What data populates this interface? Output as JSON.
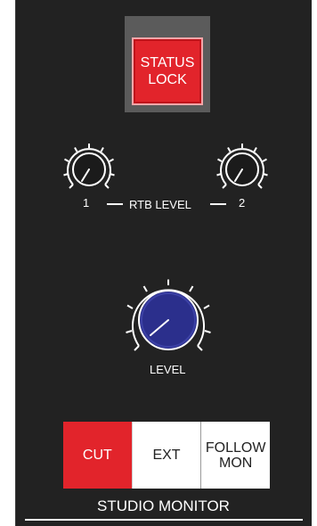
{
  "status_button": {
    "line1": "STATUS",
    "line2": "LOCK"
  },
  "rtb": {
    "label": "RTB LEVEL",
    "knob1_label": "1",
    "knob2_label": "2"
  },
  "level": {
    "label": "LEVEL"
  },
  "buttons": {
    "cut": "CUT",
    "ext": "EXT",
    "follow_line1": "FOLLOW",
    "follow_line2": "MON"
  },
  "footer": {
    "title": "STUDIO MONITOR"
  },
  "colors": {
    "panel": "#222222",
    "accent_red": "#e2242b",
    "level_knob_blue": "#2b2f8c",
    "bezel_gray": "#5b5b5b"
  }
}
